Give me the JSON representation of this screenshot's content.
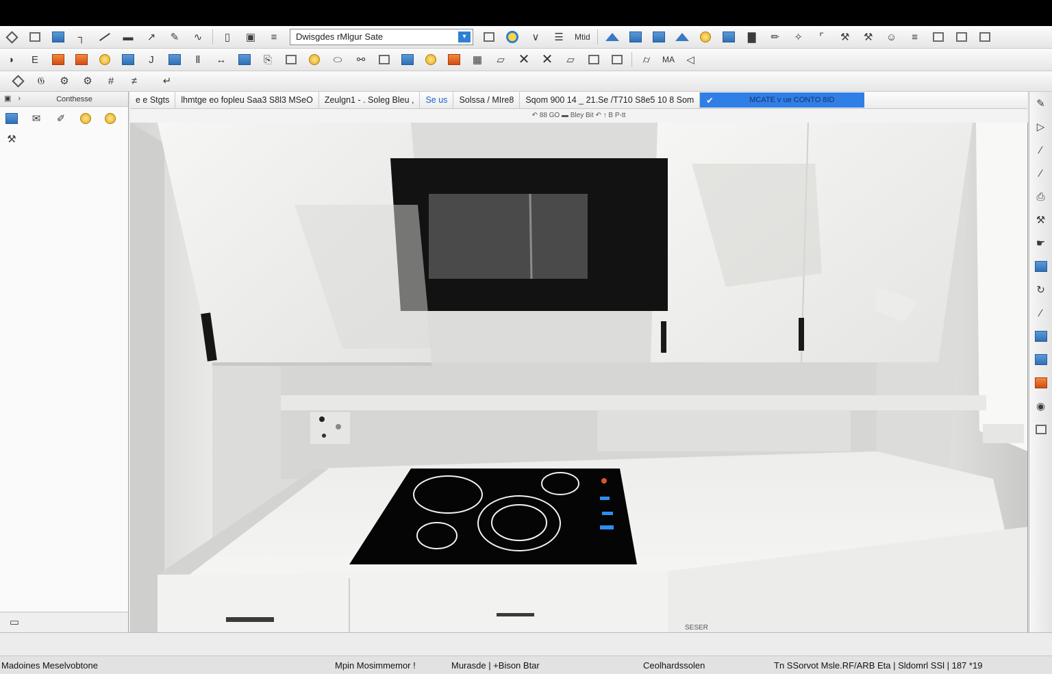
{
  "toolbar_row1": {
    "search_field_value": "Dwisgdes rMlgur Sate",
    "label_right": "Mtid"
  },
  "toolbar_row2": {
    "label_right": "MA"
  },
  "left_panel": {
    "header_title": "Conthesse"
  },
  "info_bar": {
    "cell1": "e e Stgts",
    "cell2": "lhmtge  eo fopleu  Saa3 S8l3 MSeO",
    "cell3": "Zeulgn1 -  .  Soleg Bleu ,",
    "cell4": "Se us",
    "cell5": "Solssa / MIre8",
    "cell6": "Sqom 900 14 _    21.Se /T710 S8e5 10 8 Som",
    "banner": "MCATE  v ue  CONTO 8ID"
  },
  "subhead_text": "↶ 88 GO ▬ Bley Bit  ↶ ↑ B P-tt",
  "viewport": {
    "oven_panel_label": "SESER"
  },
  "status_bar": {
    "left": "Madoines Meselvobtone",
    "mid1": "Mpin Mosimmemor !",
    "mid2": "Murasde  |  +Bison Btar",
    "mid3": "Ceolhardssolen",
    "right": "Tn SSorvot Msle.RF/ARB Eta  |  Sldomrl SSl  |  187 *19"
  },
  "colors": {
    "accent_blue": "#2f7fe6",
    "cooktop": "#050505",
    "cabinet": "#f2f2f0"
  }
}
